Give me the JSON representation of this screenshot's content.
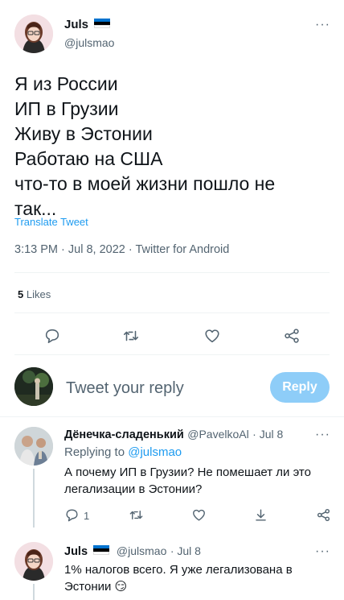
{
  "main_tweet": {
    "author_name": "Juls",
    "author_handle": "@julsmao",
    "more": "···",
    "text_lines": [
      "Я из России",
      "ИП в Грузии",
      "Живу в Эстонии",
      "Работаю на США",
      "что-то в моей жизни пошло не",
      "так..."
    ],
    "translate_label": "Translate Tweet",
    "meta": "3:13 PM · Jul 8, 2022 · Twitter for Android",
    "likes_count": "5",
    "likes_label": "Likes"
  },
  "reply_box": {
    "placeholder": "Tweet your reply",
    "button_label": "Reply"
  },
  "replies": [
    {
      "author_name": "Дёнечка-сладенький",
      "author_handle": "@PavelkoAl",
      "date": "· Jul 8",
      "replying_to_prefix": "Replying to",
      "replying_to_handle": "@julsmao",
      "text_lines": [
        "А почему ИП в Грузии? Не помешает ли это",
        "легализации в Эстонии?"
      ],
      "reply_count": "1"
    },
    {
      "author_name": "Juls",
      "author_handle": "@julsmao",
      "date": "· Jul 8",
      "text_lines": [
        "1% налогов всего. Я уже легализована в",
        "Эстонии"
      ],
      "emoji": "😏"
    }
  ],
  "colors": {
    "accent": "#1d9bf0",
    "reply_button_disabled": "#8ecdf8",
    "secondary_text": "#536471",
    "flag_estonia": [
      "#0072ce",
      "#000000",
      "#ffffff"
    ]
  },
  "icons": {
    "reply": "speech-bubble-icon",
    "retweet": "retweet-icon",
    "like": "heart-icon",
    "share": "share-icon",
    "more": "more-dots-icon"
  }
}
